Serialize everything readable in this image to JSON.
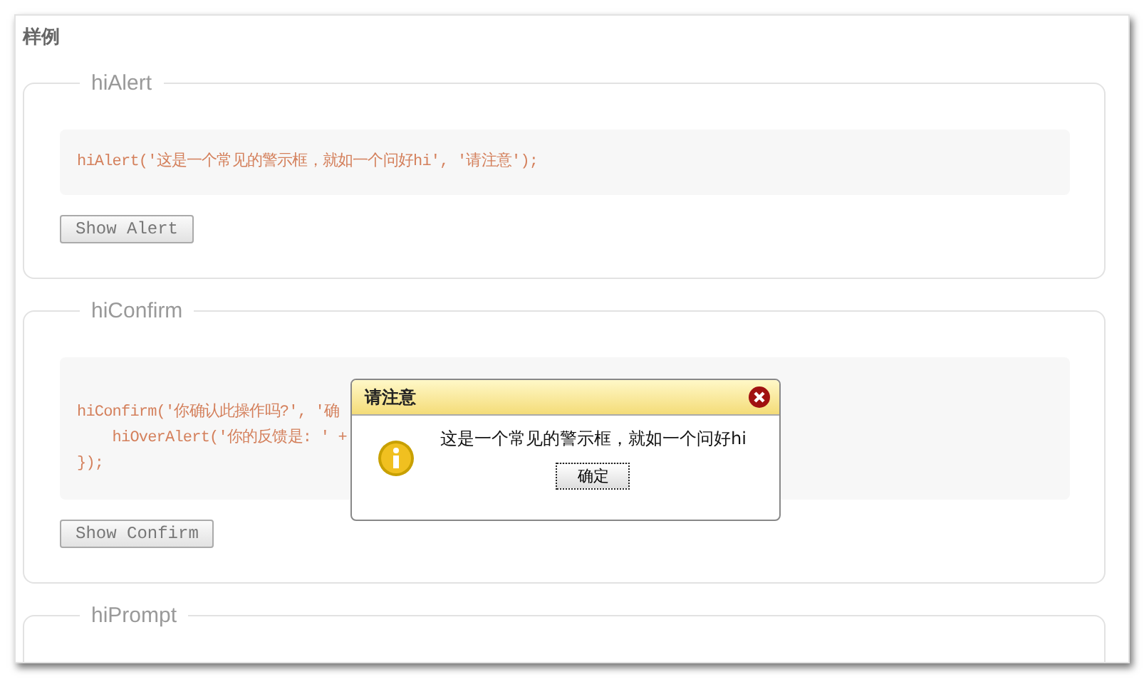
{
  "heading": "样例",
  "sections": [
    {
      "legend": "hiAlert",
      "code": [
        "hiAlert('这是一个常见的警示框，就如一个问好hi', '请注意');"
      ],
      "button": "Show Alert"
    },
    {
      "legend": "hiConfirm",
      "code": [
        "hiConfirm('你确认此操作吗?', '确",
        "    hiOverAlert('你的反馈是: ' +",
        "});"
      ],
      "button": "Show Confirm"
    },
    {
      "legend": "hiPrompt"
    }
  ],
  "dialog": {
    "title": "请注意",
    "message": "这是一个常见的警示框，就如一个问好hi",
    "button": "确定"
  }
}
